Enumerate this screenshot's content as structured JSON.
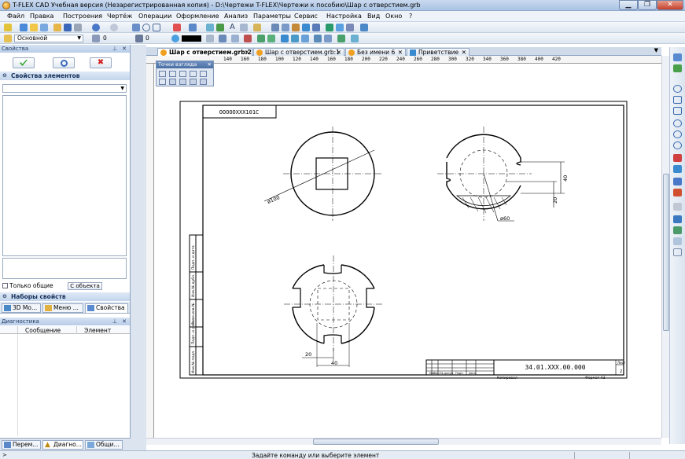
{
  "window": {
    "title": "T-FLEX CAD Учебная версия (Незарегистрированная копия) - D:\\Чертежи T-FLEX\\Чертежи к пособию\\Шар с отверстием.grb"
  },
  "menu": [
    "Файл",
    "Правка",
    "Построения",
    "Чертёж",
    "Операции",
    "Оформление",
    "Анализ",
    "Параметры",
    "Сервис",
    "Настройка",
    "Вид",
    "Окно",
    "?"
  ],
  "toolbar": {
    "layer": "Основной",
    "val1": "0",
    "val2": "0"
  },
  "properties": {
    "title": "Свойства",
    "section": "Свойства элементов",
    "only_common": "Только общие",
    "from_object": "С объекта",
    "sets": "Наборы свойств"
  },
  "prop_tabs": [
    "3D Мо...",
    "Меню ...",
    "Свойства"
  ],
  "diagnostics": {
    "title": "Диагностика",
    "col_message": "Сообщение",
    "col_element": "Элемент"
  },
  "bottom_tabs": [
    "Перем...",
    "Диагно...",
    "Общи..."
  ],
  "doc_tabs": [
    "Шар с отверстием.grb:2",
    "Шар с отверстием.grb:1",
    "Без имени 6",
    "Приветствие"
  ],
  "viewpoints": {
    "title": "Точки взгляда"
  },
  "ruler_labels": [
    "140",
    "160",
    "180",
    "100",
    "120",
    "140",
    "160",
    "180",
    "200",
    "220",
    "240",
    "260",
    "280",
    "300",
    "320",
    "340",
    "360",
    "380",
    "400",
    "420"
  ],
  "drawing": {
    "stamp_code": "ОООООХХХ101С",
    "dim_d100": "ø100",
    "dim_d60": "ø60",
    "dim_40v": "40",
    "dim_20v": "20",
    "dim_20h": "20",
    "dim_40h": "40",
    "title_code": "34.01.XXX.00.000",
    "lit": "Лист",
    "sheet_num": "2",
    "copied": "Копировал",
    "format": "Формат А3",
    "row_labels": [
      "Изм",
      "Лист",
      "№ докум.",
      "Подп.",
      "Дата"
    ],
    "side_labels": [
      "Подп. и дата",
      "Инв.№ дубл.",
      "Взам.инв.№",
      "Подп. и дата",
      "Инв.№ подл."
    ]
  },
  "status": {
    "prompt": ">",
    "message": "Задайте команду или выберите элемент"
  }
}
